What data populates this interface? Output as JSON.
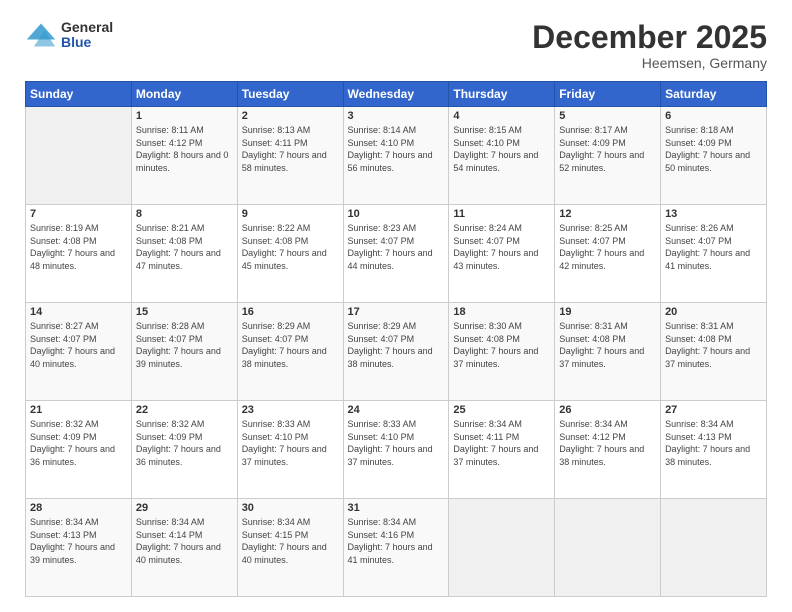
{
  "header": {
    "logo_general": "General",
    "logo_blue": "Blue",
    "month_title": "December 2025",
    "location": "Heemsen, Germany"
  },
  "days_of_week": [
    "Sunday",
    "Monday",
    "Tuesday",
    "Wednesday",
    "Thursday",
    "Friday",
    "Saturday"
  ],
  "weeks": [
    [
      {
        "day": "",
        "empty": true
      },
      {
        "day": "1",
        "sunrise": "Sunrise: 8:11 AM",
        "sunset": "Sunset: 4:12 PM",
        "daylight": "Daylight: 8 hours and 0 minutes."
      },
      {
        "day": "2",
        "sunrise": "Sunrise: 8:13 AM",
        "sunset": "Sunset: 4:11 PM",
        "daylight": "Daylight: 7 hours and 58 minutes."
      },
      {
        "day": "3",
        "sunrise": "Sunrise: 8:14 AM",
        "sunset": "Sunset: 4:10 PM",
        "daylight": "Daylight: 7 hours and 56 minutes."
      },
      {
        "day": "4",
        "sunrise": "Sunrise: 8:15 AM",
        "sunset": "Sunset: 4:10 PM",
        "daylight": "Daylight: 7 hours and 54 minutes."
      },
      {
        "day": "5",
        "sunrise": "Sunrise: 8:17 AM",
        "sunset": "Sunset: 4:09 PM",
        "daylight": "Daylight: 7 hours and 52 minutes."
      },
      {
        "day": "6",
        "sunrise": "Sunrise: 8:18 AM",
        "sunset": "Sunset: 4:09 PM",
        "daylight": "Daylight: 7 hours and 50 minutes."
      }
    ],
    [
      {
        "day": "7",
        "sunrise": "Sunrise: 8:19 AM",
        "sunset": "Sunset: 4:08 PM",
        "daylight": "Daylight: 7 hours and 48 minutes."
      },
      {
        "day": "8",
        "sunrise": "Sunrise: 8:21 AM",
        "sunset": "Sunset: 4:08 PM",
        "daylight": "Daylight: 7 hours and 47 minutes."
      },
      {
        "day": "9",
        "sunrise": "Sunrise: 8:22 AM",
        "sunset": "Sunset: 4:08 PM",
        "daylight": "Daylight: 7 hours and 45 minutes."
      },
      {
        "day": "10",
        "sunrise": "Sunrise: 8:23 AM",
        "sunset": "Sunset: 4:07 PM",
        "daylight": "Daylight: 7 hours and 44 minutes."
      },
      {
        "day": "11",
        "sunrise": "Sunrise: 8:24 AM",
        "sunset": "Sunset: 4:07 PM",
        "daylight": "Daylight: 7 hours and 43 minutes."
      },
      {
        "day": "12",
        "sunrise": "Sunrise: 8:25 AM",
        "sunset": "Sunset: 4:07 PM",
        "daylight": "Daylight: 7 hours and 42 minutes."
      },
      {
        "day": "13",
        "sunrise": "Sunrise: 8:26 AM",
        "sunset": "Sunset: 4:07 PM",
        "daylight": "Daylight: 7 hours and 41 minutes."
      }
    ],
    [
      {
        "day": "14",
        "sunrise": "Sunrise: 8:27 AM",
        "sunset": "Sunset: 4:07 PM",
        "daylight": "Daylight: 7 hours and 40 minutes."
      },
      {
        "day": "15",
        "sunrise": "Sunrise: 8:28 AM",
        "sunset": "Sunset: 4:07 PM",
        "daylight": "Daylight: 7 hours and 39 minutes."
      },
      {
        "day": "16",
        "sunrise": "Sunrise: 8:29 AM",
        "sunset": "Sunset: 4:07 PM",
        "daylight": "Daylight: 7 hours and 38 minutes."
      },
      {
        "day": "17",
        "sunrise": "Sunrise: 8:29 AM",
        "sunset": "Sunset: 4:07 PM",
        "daylight": "Daylight: 7 hours and 38 minutes."
      },
      {
        "day": "18",
        "sunrise": "Sunrise: 8:30 AM",
        "sunset": "Sunset: 4:08 PM",
        "daylight": "Daylight: 7 hours and 37 minutes."
      },
      {
        "day": "19",
        "sunrise": "Sunrise: 8:31 AM",
        "sunset": "Sunset: 4:08 PM",
        "daylight": "Daylight: 7 hours and 37 minutes."
      },
      {
        "day": "20",
        "sunrise": "Sunrise: 8:31 AM",
        "sunset": "Sunset: 4:08 PM",
        "daylight": "Daylight: 7 hours and 37 minutes."
      }
    ],
    [
      {
        "day": "21",
        "sunrise": "Sunrise: 8:32 AM",
        "sunset": "Sunset: 4:09 PM",
        "daylight": "Daylight: 7 hours and 36 minutes."
      },
      {
        "day": "22",
        "sunrise": "Sunrise: 8:32 AM",
        "sunset": "Sunset: 4:09 PM",
        "daylight": "Daylight: 7 hours and 36 minutes."
      },
      {
        "day": "23",
        "sunrise": "Sunrise: 8:33 AM",
        "sunset": "Sunset: 4:10 PM",
        "daylight": "Daylight: 7 hours and 37 minutes."
      },
      {
        "day": "24",
        "sunrise": "Sunrise: 8:33 AM",
        "sunset": "Sunset: 4:10 PM",
        "daylight": "Daylight: 7 hours and 37 minutes."
      },
      {
        "day": "25",
        "sunrise": "Sunrise: 8:34 AM",
        "sunset": "Sunset: 4:11 PM",
        "daylight": "Daylight: 7 hours and 37 minutes."
      },
      {
        "day": "26",
        "sunrise": "Sunrise: 8:34 AM",
        "sunset": "Sunset: 4:12 PM",
        "daylight": "Daylight: 7 hours and 38 minutes."
      },
      {
        "day": "27",
        "sunrise": "Sunrise: 8:34 AM",
        "sunset": "Sunset: 4:13 PM",
        "daylight": "Daylight: 7 hours and 38 minutes."
      }
    ],
    [
      {
        "day": "28",
        "sunrise": "Sunrise: 8:34 AM",
        "sunset": "Sunset: 4:13 PM",
        "daylight": "Daylight: 7 hours and 39 minutes."
      },
      {
        "day": "29",
        "sunrise": "Sunrise: 8:34 AM",
        "sunset": "Sunset: 4:14 PM",
        "daylight": "Daylight: 7 hours and 40 minutes."
      },
      {
        "day": "30",
        "sunrise": "Sunrise: 8:34 AM",
        "sunset": "Sunset: 4:15 PM",
        "daylight": "Daylight: 7 hours and 40 minutes."
      },
      {
        "day": "31",
        "sunrise": "Sunrise: 8:34 AM",
        "sunset": "Sunset: 4:16 PM",
        "daylight": "Daylight: 7 hours and 41 minutes."
      },
      {
        "day": "",
        "empty": true
      },
      {
        "day": "",
        "empty": true
      },
      {
        "day": "",
        "empty": true
      }
    ]
  ]
}
